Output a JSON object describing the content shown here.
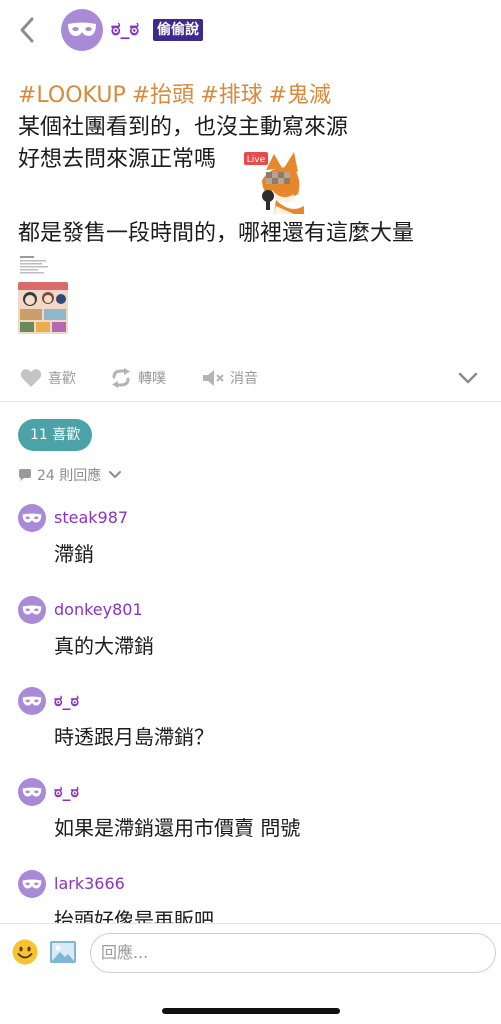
{
  "header": {
    "author_name": "ಠ_ಠ",
    "anon_badge": "偷偷說",
    "icons": [
      "back-chevron-icon",
      "mask-icon"
    ]
  },
  "post": {
    "tags": [
      "#LOOKUP",
      "#抬頭",
      "#排球",
      "#鬼滅"
    ],
    "lines": [
      "某個社團看到的，也沒主動寫來源",
      "好想去問來源正常嗎",
      "都是發售一段時間的，哪裡還有這麼大量"
    ],
    "sticker": {
      "label": "Live",
      "icon": "fox-live-sticker"
    }
  },
  "actions": {
    "like": "喜歡",
    "share": "轉噗",
    "mute": "消音",
    "icons": [
      "heart-icon",
      "repost-icon",
      "mute-icon",
      "chevron-down-icon"
    ]
  },
  "stats": {
    "likes": "11 喜歡",
    "replies": "24 則回應"
  },
  "comments": [
    {
      "name": "steak987",
      "text": "滯銷"
    },
    {
      "name": "donkey801",
      "text": "真的大滯銷"
    },
    {
      "name": "ಠ_ಠ",
      "text": "時透跟月島滯銷？"
    },
    {
      "name": "ಠ_ಠ",
      "text": "如果是滯銷還用市價賣 問號"
    },
    {
      "name": "lark3666",
      "text": "抬頭好像是再販吧"
    }
  ],
  "composer": {
    "placeholder": "回應..."
  },
  "colors": {
    "accent_purple": "#8a32c8",
    "avatar_purple": "#a98ad6",
    "tag_orange": "#d8893a",
    "like_pill": "#4ba3a8",
    "badge": "#3d2a8c"
  }
}
